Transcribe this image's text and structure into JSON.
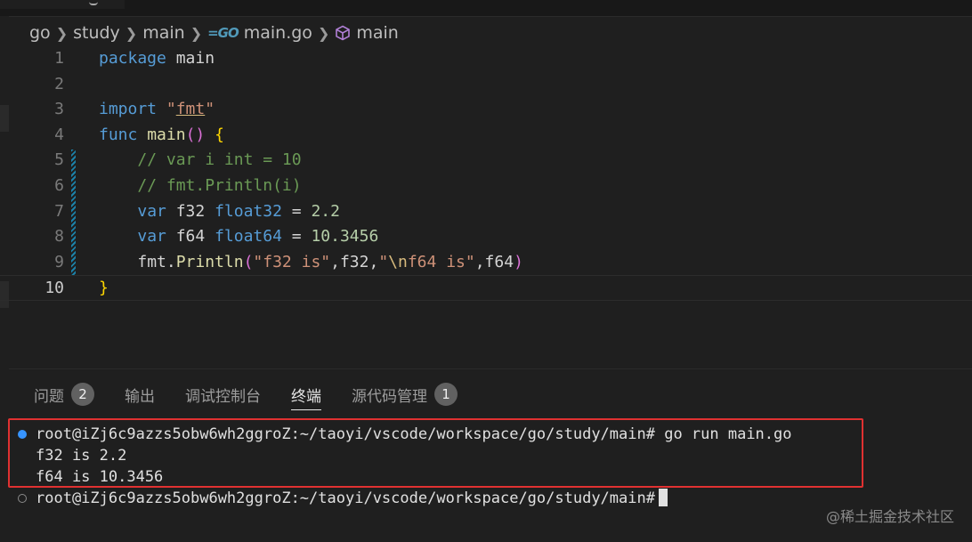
{
  "breadcrumb": {
    "items": [
      "go",
      "study",
      "main"
    ],
    "file_icon": "go-file-icon",
    "file": "main.go",
    "symbol_icon": "cube-symbol-icon",
    "symbol": "main"
  },
  "editor": {
    "line_numbers": [
      "1",
      "2",
      "3",
      "4",
      "5",
      "6",
      "7",
      "8",
      "9",
      "10"
    ],
    "active_line": "10",
    "lines": [
      "package main",
      "",
      "import \"fmt\"",
      "func main() {",
      "    // var i int = 10",
      "    // fmt.Println(i)",
      "    var f32 float32 = 2.2",
      "    var f64 float64 = 10.3456",
      "    fmt.Println(\"f32 is\",f32,\"\\nf64 is\",f64)",
      "}"
    ],
    "tokens": {
      "l1": {
        "kw": "package",
        "name": " main"
      },
      "l3": {
        "kw": "import",
        "sp": " ",
        "q1": "\"",
        "pkg": "fmt",
        "q2": "\""
      },
      "l4": {
        "kw": "func",
        "sp": " ",
        "fn": "main",
        "paren": "()",
        "sp2": " ",
        "brace": "{"
      },
      "l5": {
        "indent": "    ",
        "cmt": "// var i int = 10"
      },
      "l6": {
        "indent": "    ",
        "cmt": "// fmt.Println(i)"
      },
      "l7": {
        "indent": "    ",
        "kw": "var",
        "name": " f32 ",
        "typ": "float32",
        "eq": " = ",
        "num": "2.2"
      },
      "l8": {
        "indent": "    ",
        "kw": "var",
        "name": " f64 ",
        "typ": "float64",
        "eq": " = ",
        "num": "10.3456"
      },
      "l9": {
        "indent": "    ",
        "pkg": "fmt",
        "dot": ".",
        "fn": "Println",
        "p1": "(",
        "s1": "\"f32 is\"",
        "c1": ",f32,",
        "s2a": "\"",
        "esc": "\\n",
        "s2b": "f64 is\"",
        "c2": ",f64",
        "p2": ")"
      },
      "l10": {
        "brace": "}"
      }
    }
  },
  "panel": {
    "tabs": [
      {
        "label": "问题",
        "badge": "2"
      },
      {
        "label": "输出"
      },
      {
        "label": "调试控制台"
      },
      {
        "label": "终端",
        "active": true
      },
      {
        "label": "源代码管理",
        "badge": "1"
      }
    ]
  },
  "terminal": {
    "lines": [
      "root@iZj6c9azzs5obw6wh2ggroZ:~/taoyi/vscode/workspace/go/study/main# go run main.go",
      "f32 is 2.2",
      "f64 is 10.3456",
      "root@iZj6c9azzs5obw6wh2ggroZ:~/taoyi/vscode/workspace/go/study/main#"
    ],
    "highlight_color": "#e03131"
  },
  "watermark": "@稀土掘金技术社区",
  "colors": {
    "background": "#1f1f1f",
    "keyword": "#569cd6",
    "string": "#ce9178",
    "comment": "#6a9955",
    "function": "#dcdcaa",
    "type": "#4ec9b0",
    "number": "#b5cea8"
  }
}
